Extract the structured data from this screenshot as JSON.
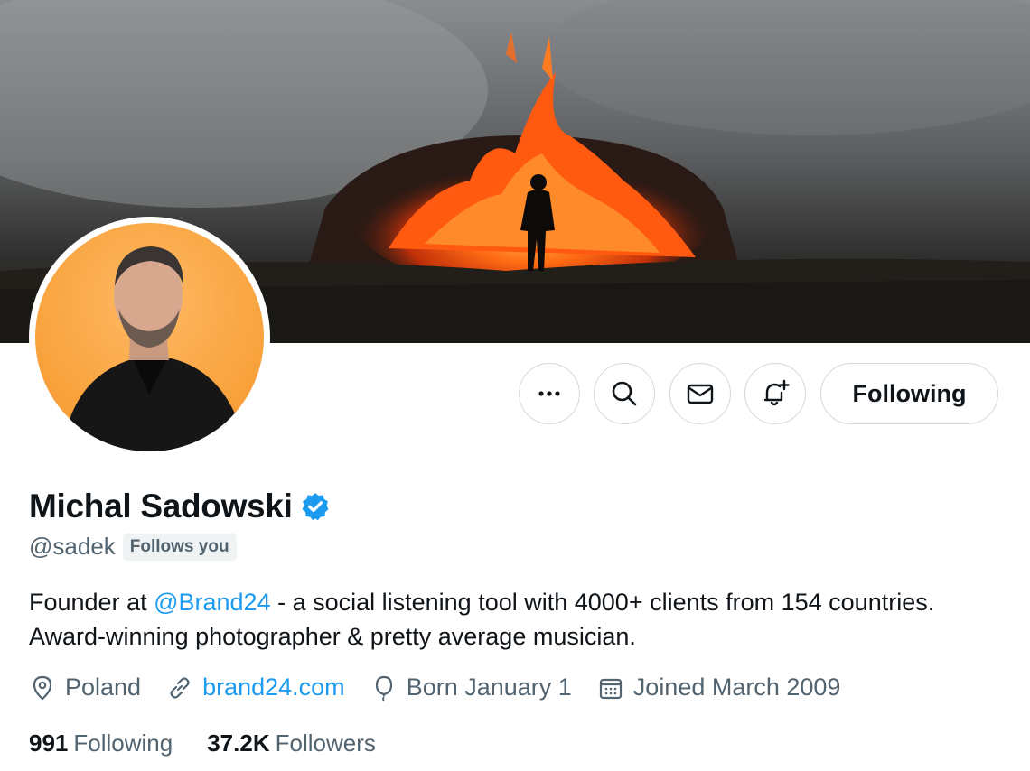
{
  "profile": {
    "display_name": "Michal Sadowski",
    "handle": "@sadek",
    "follows_you_badge": "Follows you",
    "verified_icon": "verified-badge-icon",
    "bio_prefix": "Founder at ",
    "bio_mention": "@Brand24",
    "bio_suffix": " - a social listening tool with 4000+ clients from 154 countries. Award-winning photographer & pretty average musician."
  },
  "actions": {
    "more_icon": "more-dots-icon",
    "search_icon": "search-icon",
    "message_icon": "mail-icon",
    "notify_icon": "bell-plus-icon",
    "follow_label": "Following"
  },
  "meta": {
    "location": "Poland",
    "website": "brand24.com",
    "birthday": "Born January 1",
    "joined": "Joined March 2009"
  },
  "stats": {
    "following_count": "991",
    "following_label": "Following",
    "followers_count": "37.2K",
    "followers_label": "Followers"
  },
  "colors": {
    "accent": "#1d9bf0",
    "secondary_text": "#536471",
    "border": "#cfd9de",
    "avatar_bg": "#f9a43f",
    "lava": "#ff5a10"
  }
}
